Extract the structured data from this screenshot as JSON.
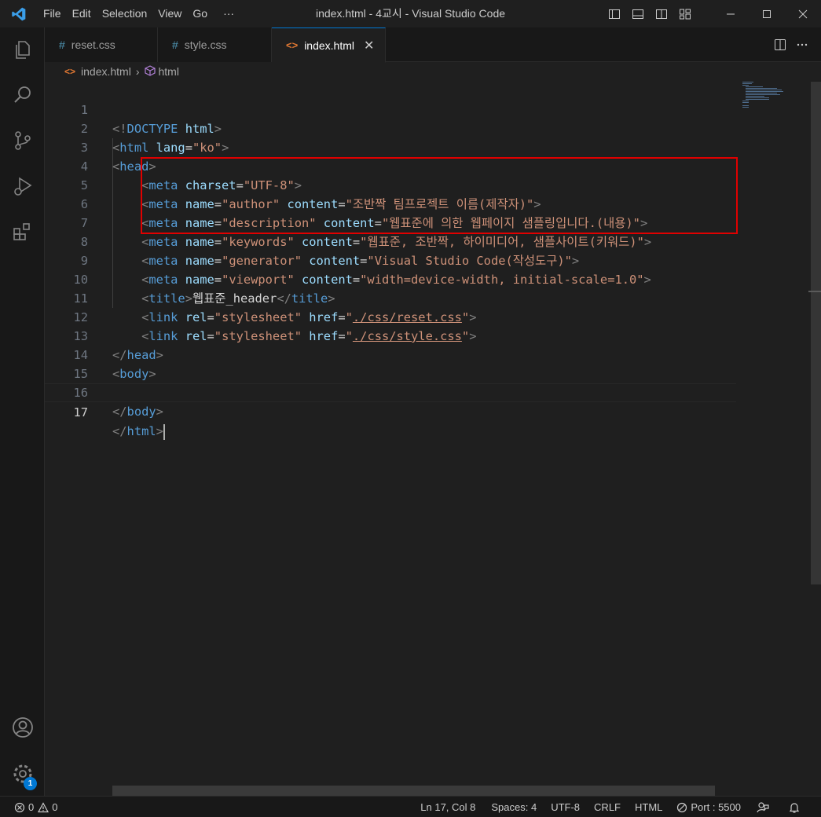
{
  "titlebar": {
    "menu": [
      "File",
      "Edit",
      "Selection",
      "View",
      "Go",
      "···"
    ],
    "title": "index.html - 4교시 - Visual Studio Code",
    "layout_icons": [
      "toggle-primary-sidebar-icon",
      "toggle-panel-icon",
      "toggle-secondary-sidebar-icon",
      "customize-layout-icon"
    ],
    "window_controls": [
      "minimize-icon",
      "maximize-icon",
      "close-icon"
    ]
  },
  "activitybar": {
    "items": [
      "explorer-icon",
      "search-icon",
      "source-control-icon",
      "run-debug-icon",
      "extensions-icon"
    ],
    "bottom": [
      "accounts-icon",
      "manage-gear-icon"
    ],
    "manage_badge": "1"
  },
  "tabs": [
    {
      "label": "reset.css",
      "icon": "#",
      "active": false
    },
    {
      "label": "style.css",
      "icon": "#",
      "active": false
    },
    {
      "label": "index.html",
      "icon": "<>",
      "active": true
    }
  ],
  "tab_close": "✕",
  "breadcrumb": {
    "file": "index.html",
    "symbol": "html"
  },
  "code": {
    "line_numbers": [
      "1",
      "2",
      "3",
      "4",
      "5",
      "6",
      "7",
      "8",
      "9",
      "10",
      "11",
      "12",
      "13",
      "14",
      "15",
      "16",
      "17"
    ],
    "current_line": "17",
    "l1": {
      "a": "<!",
      "b": "DOCTYPE",
      "c": " ",
      "d": "html",
      "e": ">"
    },
    "l2": {
      "a": "<",
      "b": "html",
      "c": " lang",
      "d": "=",
      "e": "\"ko\"",
      "f": ">"
    },
    "l3": {
      "a": "<",
      "b": "head",
      "c": ">"
    },
    "l4": {
      "a": "<",
      "b": "meta",
      "c": " charset",
      "d": "=",
      "e": "\"UTF-8\"",
      "f": ">"
    },
    "l5": {
      "a": "<",
      "b": "meta",
      "c": " name",
      "d": "=",
      "e": "\"author\"",
      "f": " content",
      "g": "=",
      "h": "\"조반짝 팀프로젝트 이름(제작자)\"",
      "i": ">"
    },
    "l6": {
      "a": "<",
      "b": "meta",
      "c": " name",
      "d": "=",
      "e": "\"description\"",
      "f": " content",
      "g": "=",
      "h": "\"웹표준에 의한 웹페이지 샘플링입니다.(내용)\"",
      "i": ">"
    },
    "l7": {
      "a": "<",
      "b": "meta",
      "c": " name",
      "d": "=",
      "e": "\"keywords\"",
      "f": " content",
      "g": "=",
      "h": "\"웹표준, 조반짝, 하이미디어, 샘플사이트(키워드)\"",
      "i": ">"
    },
    "l8": {
      "a": "<",
      "b": "meta",
      "c": " name",
      "d": "=",
      "e": "\"generator\"",
      "f": " content",
      "g": "=",
      "h": "\"Visual Studio Code(작성도구)\"",
      "i": ">"
    },
    "l9": {
      "a": "<",
      "b": "meta",
      "c": " name",
      "d": "=",
      "e": "\"viewport\"",
      "f": " content",
      "g": "=",
      "h": "\"width=device-width, initial-scale=1.0\"",
      "i": ">"
    },
    "l10": {
      "a": "<",
      "b": "title",
      "c": ">",
      "d": "웹표준_header",
      "e": "</",
      "f": "title",
      "g": ">"
    },
    "l11": {
      "a": "<",
      "b": "link",
      "c": " rel",
      "d": "=",
      "e": "\"stylesheet\"",
      "f": " href",
      "g": "=",
      "h1": "\"",
      "h2": "./css/reset.css",
      "h3": "\"",
      "i": ">"
    },
    "l12": {
      "a": "<",
      "b": "link",
      "c": " rel",
      "d": "=",
      "e": "\"stylesheet\"",
      "f": " href",
      "g": "=",
      "h1": "\"",
      "h2": "./css/style.css",
      "h3": "\"",
      "i": ">"
    },
    "l13": {
      "a": "</",
      "b": "head",
      "c": ">"
    },
    "l14": {
      "a": "<",
      "b": "body",
      "c": ">"
    },
    "l16": {
      "a": "</",
      "b": "body",
      "c": ">"
    },
    "l17": {
      "a": "</",
      "b": "html",
      "c": ">"
    }
  },
  "colors": {
    "tag": "#569cd6",
    "attribute": "#9cdcfe",
    "string": "#ce9178",
    "bracket": "#808080",
    "highlight_box": "#e00000",
    "badge": "#0078d4"
  },
  "statusbar": {
    "errors": "0",
    "warnings": "0",
    "position": "Ln 17, Col 8",
    "spaces": "Spaces: 4",
    "encoding": "UTF-8",
    "eol": "CRLF",
    "language": "HTML",
    "port": "Port : 5500"
  }
}
